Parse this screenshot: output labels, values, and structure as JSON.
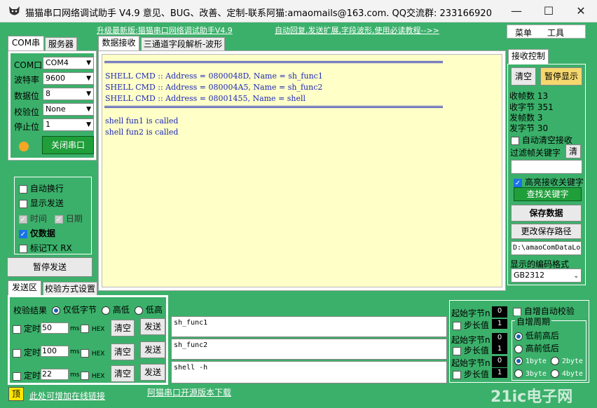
{
  "window": {
    "title": "猫猫串口网络调试助手 V4.9 意见、BUG、改善、定制-联系阿猫:amaomails@163.com. QQ交流群: 233166920",
    "minimize": "—",
    "maximize": "☐",
    "close": "✕"
  },
  "links": {
    "upgrade": "升级最新版:猫猫串口网络调试助手V4.9",
    "autoreply": "自动回复,发送扩展,字段波形,使用必读教程-->>",
    "online": "此处可增加在线链接",
    "opensource": "阿猫串口开源版本下载"
  },
  "menu": {
    "menu": "菜单",
    "tools": "工具"
  },
  "left_tabs": {
    "com": "COM串口",
    "server": "服务器"
  },
  "serial": {
    "port_label": "COM口",
    "port_value": "COM4",
    "baud_label": "波特率",
    "baud_value": "9600",
    "databits_label": "数据位",
    "databits_value": "8",
    "parity_label": "校验位",
    "parity_value": "None",
    "stopbits_label": "停止位",
    "stopbits_value": "1",
    "close_btn": "关闭串口",
    "status_color": "#f5a623"
  },
  "display_opts": {
    "autowrap": "自动换行",
    "showsend": "显示发送",
    "time": "时间",
    "date": "日期",
    "dataonly": "仅数据",
    "marktxrx": "标记TX RX"
  },
  "pause_send": "暂停发送",
  "send_tabs": {
    "send": "发送区",
    "verify": "校验方式设置"
  },
  "verify": {
    "label": "校验结果",
    "opt1": "仅低字节",
    "opt2": "高低",
    "opt3": "低高"
  },
  "send_rows": [
    {
      "timer": "定时",
      "value": "50",
      "unit": "ms",
      "hex": "HEX",
      "clear": "清空",
      "send": "发送",
      "text": "sh_func1"
    },
    {
      "timer": "定时",
      "value": "100",
      "unit": "ms",
      "hex": "HEX",
      "clear": "清空",
      "send": "发送",
      "text": "sh_func2"
    },
    {
      "timer": "定时",
      "value": "22",
      "unit": "ms",
      "hex": "HEX",
      "clear": "清空",
      "send": "发送",
      "text": "shell -h"
    }
  ],
  "main_tabs": {
    "rx": "数据接收",
    "wave": "三通道字段解析-波形"
  },
  "rx_lines": {
    "l1": "SHELL CMD :: Address = 0800048D, Name = sh_func1",
    "l2": "SHELL CMD :: Address = 080004A5, Name = sh_func2",
    "l3": "SHELL CMD :: Address = 08001455, Name = shell",
    "l4": "shell fun1 is called",
    "l5": "shell fun2 is called"
  },
  "rx_ctrl": {
    "tab": "接收控制",
    "clear": "清空",
    "pause": "暂停显示",
    "frames": "收帧数 13",
    "bytes": "收字节 351",
    "txframes": "发帧数 3",
    "txbytes": "发字节 30",
    "autoclear": "自动清空接收",
    "filter": "过滤帧关键字",
    "filter_clear": "清",
    "highlight": "高亮接收关键字",
    "find": "查找关键字",
    "save": "保存数据",
    "change_path": "更改保存路径",
    "path": "D:\\amaoComDataLo",
    "encoding_label": "显示的编码格式",
    "encoding": "GB2312"
  },
  "checksum": {
    "start1": "起始字节n",
    "start1_val": "0",
    "step1": "步长值",
    "step1_val": "1",
    "start2": "起始字节n",
    "start2_val": "0",
    "step2": "步长值",
    "step2_val": "1",
    "start3": "起始字节n",
    "start3_val": "0",
    "step3": "步长值",
    "step3_val": "1",
    "auto_inc": "自增自动校验",
    "period": "自增周期",
    "lowfirst": "低前高后",
    "highfirst": "高前低后",
    "b1": "1byte",
    "b2": "2byte",
    "b3": "3byte",
    "b4": "4byte"
  },
  "corner": "顶",
  "watermark": "21ic电子网"
}
